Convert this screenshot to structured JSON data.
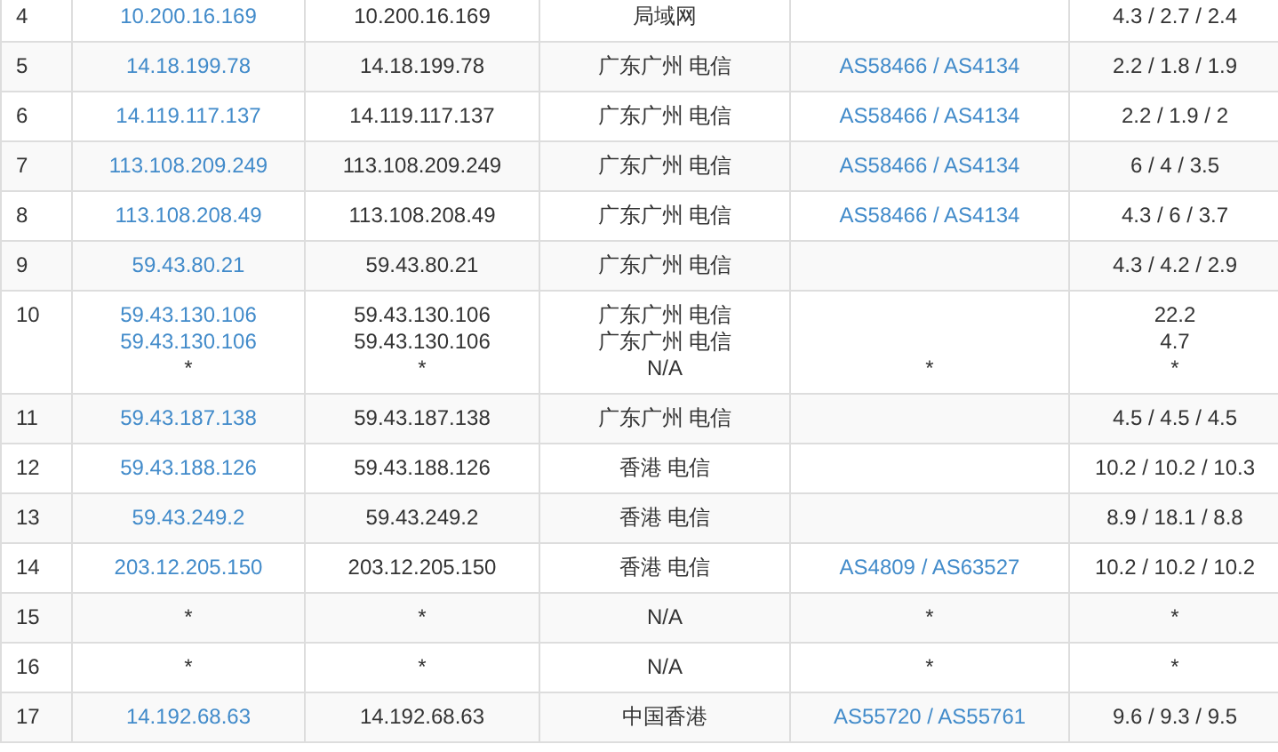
{
  "rows": [
    {
      "hop": "4",
      "ip": [
        {
          "text": "10.200.16.169",
          "link": true
        }
      ],
      "host": [
        "10.200.16.169"
      ],
      "location": [
        "局域网"
      ],
      "latency": [
        "4.3 / 2.7 / 2.4"
      ]
    },
    {
      "hop": "5",
      "ip": [
        {
          "text": "14.18.199.78",
          "link": true
        }
      ],
      "host": [
        "14.18.199.78"
      ],
      "location": [
        "广东广州 电信"
      ],
      "asn": [
        {
          "text": "AS58466 / AS4134",
          "link": true
        }
      ],
      "latency": [
        "2.2 / 1.8 / 1.9"
      ]
    },
    {
      "hop": "6",
      "ip": [
        {
          "text": "14.119.117.137",
          "link": true
        }
      ],
      "host": [
        "14.119.117.137"
      ],
      "location": [
        "广东广州 电信"
      ],
      "asn": [
        {
          "text": "AS58466 / AS4134",
          "link": true
        }
      ],
      "latency": [
        "2.2 / 1.9 / 2"
      ]
    },
    {
      "hop": "7",
      "ip": [
        {
          "text": "113.108.209.249",
          "link": true
        }
      ],
      "host": [
        "113.108.209.249"
      ],
      "location": [
        "广东广州 电信"
      ],
      "asn": [
        {
          "text": "AS58466 / AS4134",
          "link": true
        }
      ],
      "latency": [
        "6 / 4 / 3.5"
      ]
    },
    {
      "hop": "8",
      "ip": [
        {
          "text": "113.108.208.49",
          "link": true
        }
      ],
      "host": [
        "113.108.208.49"
      ],
      "location": [
        "广东广州 电信"
      ],
      "asn": [
        {
          "text": "AS58466 / AS4134",
          "link": true
        }
      ],
      "latency": [
        "4.3 / 6 / 3.7"
      ]
    },
    {
      "hop": "9",
      "ip": [
        {
          "text": "59.43.80.21",
          "link": true
        }
      ],
      "host": [
        "59.43.80.21"
      ],
      "location": [
        "广东广州 电信"
      ],
      "latency": [
        "4.3 / 4.2 / 2.9"
      ]
    },
    {
      "hop": "10",
      "ip": [
        {
          "text": "59.43.130.106",
          "link": true
        },
        {
          "text": "59.43.130.106",
          "link": true
        },
        {
          "text": "*",
          "link": false
        }
      ],
      "host": [
        "59.43.130.106",
        "59.43.130.106",
        "*"
      ],
      "location": [
        "广东广州 电信",
        "广东广州 电信",
        "N/A"
      ],
      "asn": [
        {
          "text": "*",
          "link": false
        }
      ],
      "latency": [
        "22.2",
        "4.7",
        "*"
      ]
    },
    {
      "hop": "11",
      "ip": [
        {
          "text": "59.43.187.138",
          "link": true
        }
      ],
      "host": [
        "59.43.187.138"
      ],
      "location": [
        "广东广州 电信"
      ],
      "latency": [
        "4.5 / 4.5 / 4.5"
      ]
    },
    {
      "hop": "12",
      "ip": [
        {
          "text": "59.43.188.126",
          "link": true
        }
      ],
      "host": [
        "59.43.188.126"
      ],
      "location": [
        "香港 电信"
      ],
      "latency": [
        "10.2 / 10.2 / 10.3"
      ]
    },
    {
      "hop": "13",
      "ip": [
        {
          "text": "59.43.249.2",
          "link": true
        }
      ],
      "host": [
        "59.43.249.2"
      ],
      "location": [
        "香港 电信"
      ],
      "latency": [
        "8.9 / 18.1 / 8.8"
      ]
    },
    {
      "hop": "14",
      "ip": [
        {
          "text": "203.12.205.150",
          "link": true
        }
      ],
      "host": [
        "203.12.205.150"
      ],
      "location": [
        "香港 电信"
      ],
      "asn": [
        {
          "text": "AS4809 / AS63527",
          "link": true
        }
      ],
      "latency": [
        "10.2 / 10.2 / 10.2"
      ]
    },
    {
      "hop": "15",
      "ip": [
        {
          "text": "*",
          "link": false
        }
      ],
      "host": [
        "*"
      ],
      "location": [
        "N/A"
      ],
      "asn": [
        {
          "text": "*",
          "link": false
        }
      ],
      "latency": [
        "*"
      ]
    },
    {
      "hop": "16",
      "ip": [
        {
          "text": "*",
          "link": false
        }
      ],
      "host": [
        "*"
      ],
      "location": [
        "N/A"
      ],
      "asn": [
        {
          "text": "*",
          "link": false
        }
      ],
      "latency": [
        "*"
      ]
    },
    {
      "hop": "17",
      "ip": [
        {
          "text": "14.192.68.63",
          "link": true
        }
      ],
      "host": [
        "14.192.68.63"
      ],
      "location": [
        "中国香港"
      ],
      "asn": [
        {
          "text": "AS55720 / AS55761",
          "link": true
        }
      ],
      "latency": [
        "9.6 / 9.3 / 9.5"
      ]
    }
  ]
}
